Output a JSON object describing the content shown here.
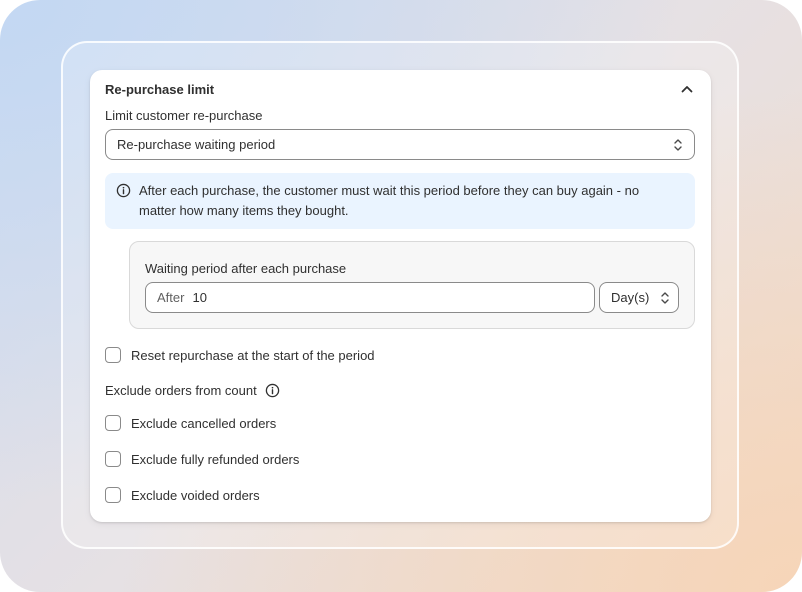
{
  "card": {
    "title": "Re-purchase limit",
    "collapse_icon": "chevron-up-icon"
  },
  "limit": {
    "label": "Limit customer re-purchase",
    "selected": "Re-purchase waiting period",
    "icon": "select-arrows-icon"
  },
  "banner": {
    "icon": "info-icon",
    "text": "After each purchase, the customer must wait this period before they can buy again - no matter how many items they bought."
  },
  "waiting_period": {
    "label": "Waiting period after each purchase",
    "prefix": "After",
    "value": "10",
    "unit": "Day(s)"
  },
  "reset": {
    "label": "Reset repurchase at the start of the period",
    "checked": false
  },
  "exclude": {
    "label": "Exclude orders from count",
    "icon": "info-icon",
    "options": [
      {
        "label": "Exclude cancelled orders",
        "checked": false
      },
      {
        "label": "Exclude fully refunded orders",
        "checked": false
      },
      {
        "label": "Exclude voided orders",
        "checked": false
      }
    ]
  },
  "colors": {
    "banner_bg": "#eaf4ff",
    "text": "#303030",
    "border": "#8a8a8a"
  }
}
